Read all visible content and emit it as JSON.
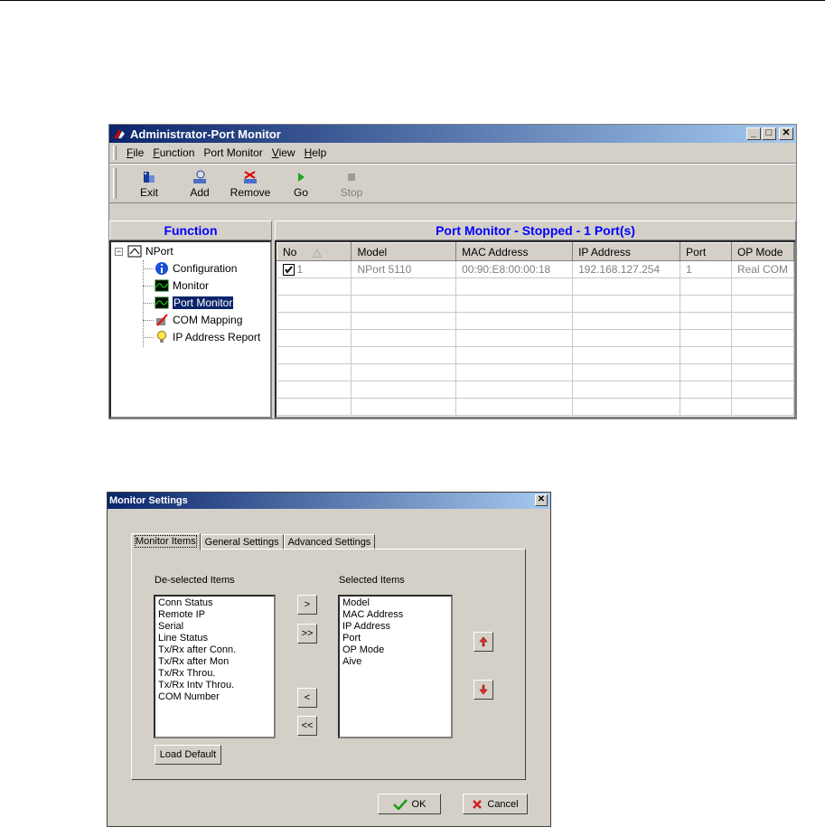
{
  "window": {
    "title": "Administrator-Port Monitor",
    "menu": [
      "File",
      "Function",
      "Port Monitor",
      "View",
      "Help"
    ],
    "toolbar": {
      "exit": "Exit",
      "add": "Add",
      "remove": "Remove",
      "go": "Go",
      "stop": "Stop"
    },
    "function_header": "Function",
    "tree": {
      "root": "NPort",
      "items": [
        "Configuration",
        "Monitor",
        "Port Monitor",
        "COM Mapping",
        "IP Address Report"
      ],
      "selected": "Port Monitor"
    },
    "main_header": "Port Monitor - Stopped - 1 Port(s)",
    "grid": {
      "columns": [
        "No",
        "Model",
        "MAC Address",
        "IP Address",
        "Port",
        "OP Mode"
      ],
      "rows": [
        [
          "1",
          "NPort 5110",
          "00:90:E8:00:00:18",
          "192.168.127.254",
          "1",
          "Real COM"
        ]
      ]
    }
  },
  "dialog": {
    "title": "Monitor Settings",
    "tabs": [
      "Monitor Items",
      "General Settings",
      "Advanced Settings"
    ],
    "active_tab": "Monitor Items",
    "deselected_label": "De-selected Items",
    "selected_label": "Selected Items",
    "deselected_items": [
      "Conn Status",
      "Remote IP",
      "Serial",
      "Line Status",
      "Tx/Rx after Conn.",
      "Tx/Rx after Mon",
      "Tx/Rx Throu.",
      "Tx/Rx Intv Throu.",
      "COM Number"
    ],
    "selected_items": [
      "Model",
      "MAC Address",
      "IP Address",
      "Port",
      "OP Mode",
      "Aive"
    ],
    "buttons": {
      "add_one": ">",
      "add_all": ">>",
      "remove_one": "<",
      "remove_all": "<<",
      "load_default": "Load Default",
      "ok": "OK",
      "cancel": "Cancel"
    }
  },
  "colors": {
    "title_gradient_start": "#0a246a",
    "title_gradient_end": "#a6caf0",
    "face": "#d4d0c8",
    "header_blue": "#0000ff"
  }
}
